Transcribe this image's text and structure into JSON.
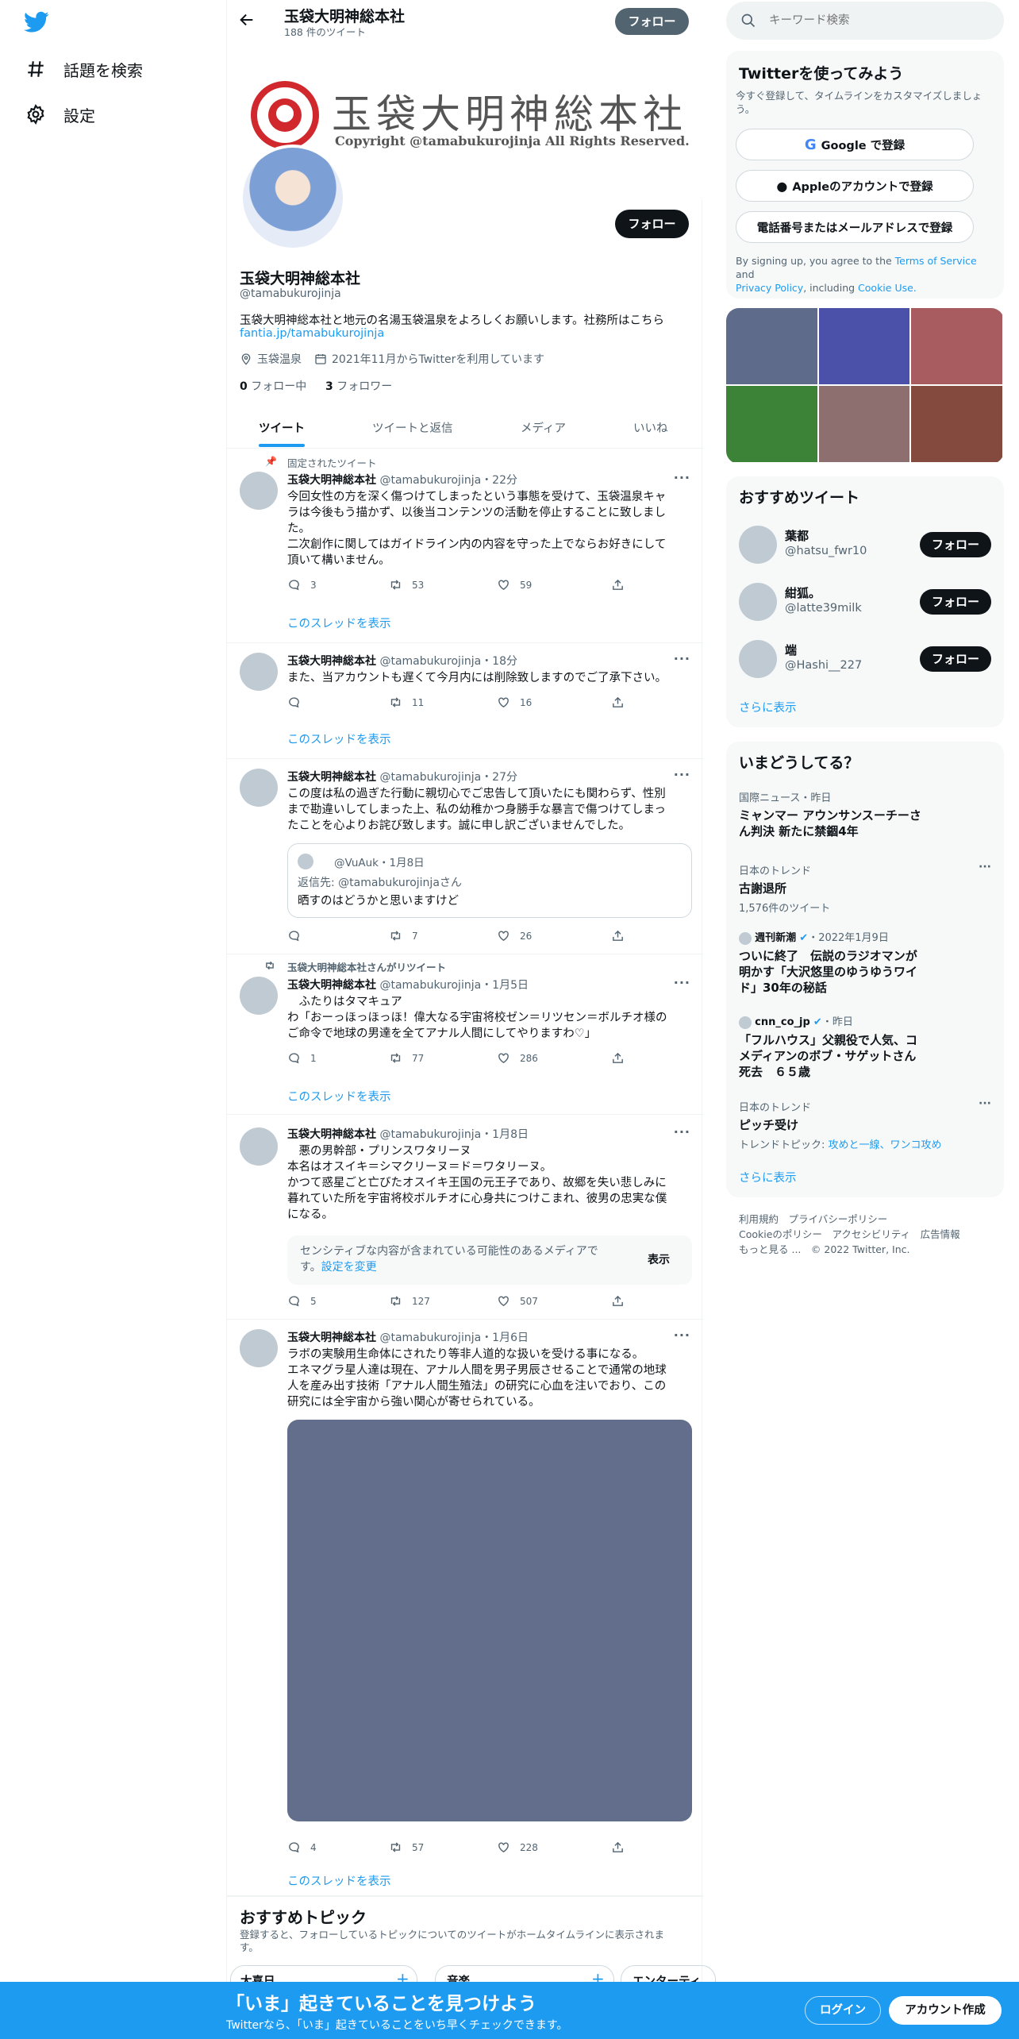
{
  "colors": {
    "accent": "#1d9bf0",
    "dark": "#0f1419",
    "gray": "#536471",
    "banner": "#1d9bf0",
    "tab_active": "#1d9bf0"
  },
  "nav": {
    "explore": "話題を検索",
    "settings": "設定"
  },
  "header": {
    "name": "玉袋大明神総本社",
    "tweet_count": "188 件のツイート",
    "follow": "フォロー"
  },
  "banner_image": {
    "title": "玉袋大明神総本社",
    "copyright": "Copyright @tamabukurojinja All Rights Reserved."
  },
  "profile": {
    "follow": "フォロー",
    "name": "玉袋大明神総本社",
    "handle": "@tamabukurojinja",
    "bio": "玉袋大明神総本社と地元の名湯玉袋温泉をよろしくお願いします。社務所はこちら",
    "bio_link": "fantia.jp/tamabukurojinja",
    "location": "玉袋温泉",
    "joined": "2021年11月からTwitterを利用しています",
    "following_count": "0",
    "following_label": "フォロー中",
    "followers_count": "3",
    "followers_label": "フォロワー"
  },
  "tabs": [
    "ツイート",
    "ツイートと返信",
    "メディア",
    "いいね"
  ],
  "tweets": [
    {
      "pinned": "固定されたツイート",
      "name": "玉袋大明神総本社",
      "handle": "@tamabukurojinja",
      "time": "・22分",
      "lines": [
        "今回女性の方を深く傷つけてしまったという事態を受けて、玉袋温泉キャ",
        "ラは今後もう描かず、以後当コンテンツの活動を停止することに致しまし",
        "た。",
        "二次創作に関してはガイドライン内の内容を守った上でならお好きにして",
        "頂いて構いません。"
      ],
      "reply": "3",
      "retweet": "53",
      "like": "59",
      "thread": "このスレッドを表示"
    },
    {
      "name": "玉袋大明神総本社",
      "handle": "@tamabukurojinja",
      "time": "・18分",
      "lines": [
        "また、当アカウントも遅くて今月内には削除致しますのでご了承下さい。"
      ],
      "reply": "",
      "retweet": "11",
      "like": "16",
      "thread": "このスレッドを表示"
    },
    {
      "name": "玉袋大明神総本社",
      "handle": "@tamabukurojinja",
      "time": "・27分",
      "lines": [
        "この度は私の過ぎた行動に親切心でご忠告して頂いたにも関わらず、性別",
        "まで勘違いしてしまった上、私の幼稚かつ身勝手な暴言で傷つけてしまっ",
        "たことを心よりお詫び致します。誠に申し訳ございませんでした。"
      ],
      "quote": {
        "handle": "@VuAuk",
        "date": "・1月8日",
        "reply_to": "返信先: @tamabukurojinjaさん",
        "text": "晒すのはどうかと思いますけど"
      },
      "reply": "",
      "retweet": "7",
      "like": "26"
    },
    {
      "retweeted_by": "玉袋大明神総本社さんがリツイート",
      "name": "玉袋大明神総本社",
      "handle": "@tamabukurojinja",
      "time": "・1月5日",
      "lines": [
        "　ふたりはタマキュア",
        "わ「おーっほっほっほ！偉大なる宇宙将校ゼン＝リツセン＝ボルチオ様の",
        "ご命令で地球の男達を全てアナル人間にしてやりますわ♡」"
      ],
      "reply": "1",
      "retweet": "77",
      "like": "286",
      "thread": "このスレッドを表示"
    },
    {
      "name": "玉袋大明神総本社",
      "handle": "@tamabukurojinja",
      "time": "・1月8日",
      "lines": [
        "　悪の男幹部・プリンスワタリーヌ",
        "本名はオスイキ＝シマクリーヌ＝ド＝ワタリーヌ。",
        "かつて惑星ごと亡びたオスイキ王国の元王子であり、故郷を失い悲しみに",
        "暮れていた所を宇宙将校ボルチオに心身共につけこまれ、彼男の忠実な僕",
        "になる。"
      ],
      "sensitive": {
        "text1": "センシティブな内容が含まれている可能性のあるメディアで",
        "text2": "す。",
        "link": "設定を変更",
        "show": "表示"
      },
      "reply": "5",
      "retweet": "127",
      "like": "507"
    },
    {
      "name": "玉袋大明神総本社",
      "handle": "@tamabukurojinja",
      "time": "・1月6日",
      "lines": [
        "ラボの実験用生命体にされたり等非人道的な扱いを受ける事になる。",
        "エネマグラ星人達は現在、アナル人間を男子男辰させることで通常の地球",
        "人を産み出す技術「アナル人間生殖法」の研究に心血を注いでおり、この",
        "研究には全宇宙から強い関心が寄せられている。"
      ],
      "reply": "4",
      "retweet": "57",
      "like": "228",
      "thread": "このスレッドを表示"
    }
  ],
  "topics": {
    "title": "おすすめトピック",
    "desc": "登録すると、フォローしているトピックについてのツイートがホームタイムラインに表示されま",
    "desc2": "す。",
    "items": [
      "大喜日",
      "音楽",
      "エンターティ"
    ]
  },
  "search": {
    "placeholder": "キーワード検索"
  },
  "signup": {
    "title": "Twitterを使ってみよう",
    "desc1": "今すぐ登録して、タイムラインをカスタマイズしましょ",
    "desc2": "う。",
    "google": "Google で登録",
    "apple": "Appleのアカウントで登録",
    "phone": "電話番号またはメールアドレスで登録",
    "terms_pre": "By signing up, you agree to the ",
    "terms": "Terms of Service",
    "terms_and": " and",
    "privacy": "Privacy Policy",
    "including": ", including ",
    "cookie": "Cookie Use."
  },
  "media_colors": [
    "#5f6b8a",
    "#4b51a8",
    "#a85c60",
    "#3c8237",
    "#8c6f6e",
    "#854a3e"
  ],
  "suggest": {
    "title": "おすすめツイート",
    "users": [
      {
        "name": "葉都",
        "handle": "@hatsu_fwr10"
      },
      {
        "name": "紺狐。",
        "handle": "@latte39milk"
      },
      {
        "name": "端",
        "handle": "@Hashi__227"
      }
    ],
    "follow": "フォロー",
    "more": "さらに表示"
  },
  "trends": {
    "title": "いまどうしてる？",
    "items": [
      {
        "meta": "国際ニュース・昨日",
        "lines": [
          "ミャンマー アウンサンスーチーさ",
          "ん判決 新たに禁錮4年"
        ]
      },
      {
        "meta": "日本のトレンド",
        "lines": [
          "古謝退所"
        ],
        "count": "1,576件のツイート"
      },
      {
        "meta_src": "週刊新潮",
        "meta_date": "・2022年1月9日",
        "lines": [
          "ついに終了　伝説のラジオマンが",
          "明かす「大沢悠里のゆうゆうワイ",
          "ド」30年の秘話"
        ]
      },
      {
        "meta_src": "cnn_co_jp",
        "meta_date": "・昨日",
        "lines": [
          "「フルハウス」父親役で人気、コ",
          "メディアンのボブ・サゲットさん",
          "死去　６５歳"
        ]
      },
      {
        "meta": "日本のトレンド",
        "lines": [
          "ピッチ受け"
        ],
        "topic_pre": "トレンドトピック: ",
        "topic": "攻めと一線、ワンコ攻め"
      }
    ],
    "more": "さらに表示"
  },
  "footer": {
    "row1": [
      "利用規約",
      "プライバシーポリシー"
    ],
    "row2": [
      "Cookieのポリシー",
      "アクセシビリティ",
      "広告情報"
    ],
    "more": "もっと見る ...",
    "copy": "© 2022 Twitter, Inc."
  },
  "bottom_banner": {
    "title": "「いま」起きていることを見つけよう",
    "sub": "Twitterなら、「いま」起きていることをいち早くチェックできます。",
    "login": "ログイン",
    "signup": "アカウント作成"
  }
}
